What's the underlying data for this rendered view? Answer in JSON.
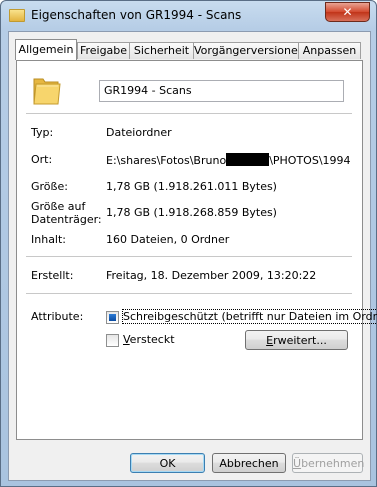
{
  "window": {
    "title": "Eigenschaften von GR1994 - Scans",
    "close_glyph": "✕"
  },
  "tabs": [
    {
      "label": "Allgemein",
      "active": true
    },
    {
      "label": "Freigabe",
      "active": false
    },
    {
      "label": "Sicherheit",
      "active": false
    },
    {
      "label": "Vorgängerversionen",
      "active": false
    },
    {
      "label": "Anpassen",
      "active": false
    }
  ],
  "general": {
    "folder_name": "GR1994 - Scans",
    "type_label": "Typ:",
    "type_value": "Dateiordner",
    "location_label": "Ort:",
    "location_prefix": "E:\\shares\\Fotos\\Bruno",
    "location_suffix": "\\PHOTOS\\1994",
    "size_label": "Größe:",
    "size_value": "1,78 GB (1.918.261.011 Bytes)",
    "disk_size_label_1": "Größe auf",
    "disk_size_label_2": "Datenträger:",
    "disk_size_value": "1,78 GB (1.918.268.859 Bytes)",
    "contents_label": "Inhalt:",
    "contents_value": "160 Dateien, 0 Ordner",
    "created_label": "Erstellt:",
    "created_value": "Freitag, 18. Dezember 2009, 13:20:22",
    "attributes_label": "Attribute:",
    "readonly_label": "Schreibgeschützt (betrifft nur Dateien im Ordner)",
    "readonly_state": "indeterminate",
    "hidden_label": "Versteckt",
    "hidden_checked": false,
    "advanced_button": "Erweitert..."
  },
  "footer": {
    "ok": "OK",
    "cancel": "Abbrechen",
    "apply": "Übernehmen"
  },
  "colors": {
    "titlebar": "#b6cde6",
    "close_button": "#c13419",
    "checkbox_fill": "#0a4aa0"
  }
}
